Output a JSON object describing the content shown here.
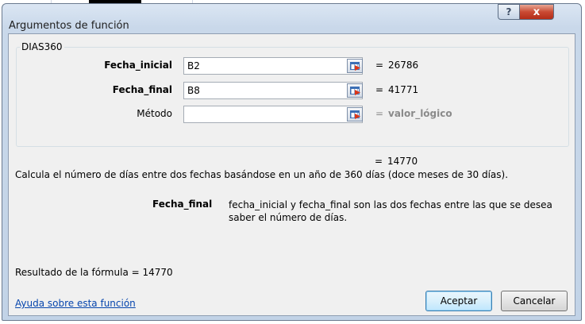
{
  "window": {
    "title": "Argumentos de función"
  },
  "titlebar": {
    "help_glyph": "?",
    "close_glyph": "x"
  },
  "function_name": "DIAS360",
  "arguments": [
    {
      "label": "Fecha_inicial",
      "value": "B2",
      "eq": "=",
      "result": "26786"
    },
    {
      "label": "Fecha_final",
      "value": "B8",
      "eq": "=",
      "result": "41771"
    },
    {
      "label": "Método",
      "value": "",
      "eq": "=",
      "result": "valor_lógico"
    }
  ],
  "overall": {
    "eq": "=",
    "result": "14770"
  },
  "description": "Calcula el número de días entre dos fechas basándose en un año de 360 días (doce meses de 30 días).",
  "arg_help": {
    "name": "Fecha_final",
    "text": "fecha_inicial y fecha_final son las dos fechas entre las que se desea saber el número de días."
  },
  "formula_result": "Resultado de la fórmula =  14770",
  "help_link": "Ayuda sobre esta función",
  "buttons": {
    "ok": "Aceptar",
    "cancel": "Cancelar"
  },
  "colors": {
    "close": "#c94a33",
    "link": "#0645ad",
    "muted": "#8a8a8a"
  }
}
